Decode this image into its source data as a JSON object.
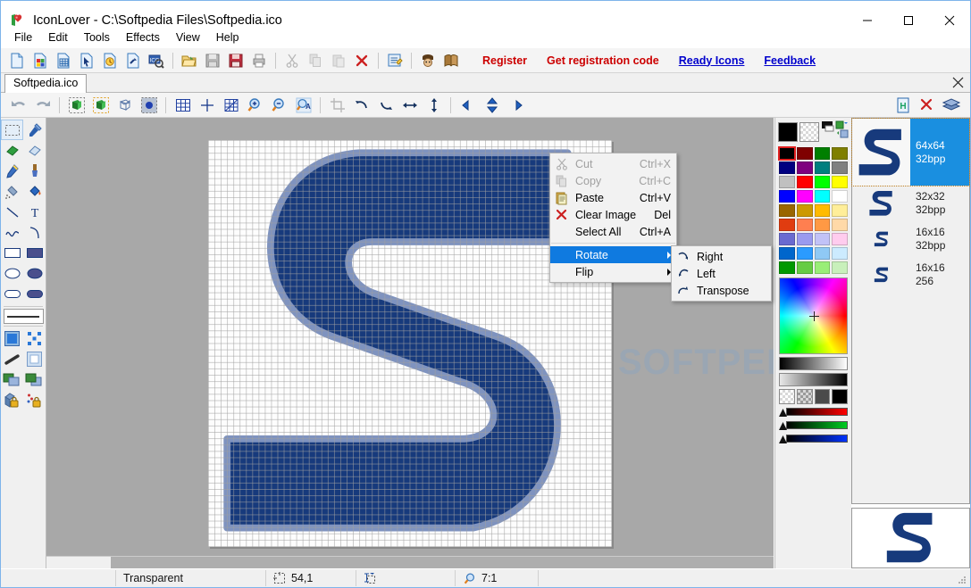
{
  "window": {
    "title": "IconLover - C:\\Softpedia Files\\Softpedia.ico",
    "app_icon": "heart-icon",
    "minimize_label": "—",
    "maximize_label": "□",
    "close_label": "✕"
  },
  "menubar": {
    "items": [
      {
        "label": "File"
      },
      {
        "label": "Edit"
      },
      {
        "label": "Tools"
      },
      {
        "label": "Effects"
      },
      {
        "label": "View"
      },
      {
        "label": "Help"
      }
    ]
  },
  "toolbar_main": {
    "icons": [
      {
        "name": "new-icon"
      },
      {
        "name": "new-image-icon"
      },
      {
        "name": "new-library-icon"
      },
      {
        "name": "new-cursor-icon"
      },
      {
        "name": "new-animated-cursor-icon"
      },
      {
        "name": "extract-icon"
      },
      {
        "name": "search-icons-icon"
      },
      {
        "name": "open-icon"
      },
      {
        "name": "save-icon"
      },
      {
        "name": "save-as-icon"
      },
      {
        "name": "print-icon"
      },
      {
        "name": "cut-icon"
      },
      {
        "name": "copy-icon"
      },
      {
        "name": "paste-icon"
      },
      {
        "name": "delete-icon"
      },
      {
        "name": "properties-icon"
      },
      {
        "name": "capture-icon"
      },
      {
        "name": "catalog-icon"
      }
    ],
    "links": [
      {
        "label": "Register",
        "style": "red"
      },
      {
        "label": "Get registration code",
        "style": "red"
      },
      {
        "label": "Ready Icons",
        "style": "blue-underline"
      },
      {
        "label": "Feedback",
        "style": "blue-underline"
      }
    ]
  },
  "tabstrip": {
    "tabs": [
      {
        "label": "Softpedia.ico",
        "active": true
      }
    ],
    "close_label": "✕"
  },
  "toolbar_edit": {
    "icons": [
      {
        "name": "undo-icon"
      },
      {
        "name": "redo-icon"
      },
      {
        "name": "image-normal-icon"
      },
      {
        "name": "image-selected-icon"
      },
      {
        "name": "image-3d-icon"
      },
      {
        "name": "image-mask-icon"
      },
      {
        "name": "grid-icon"
      },
      {
        "name": "crosshair-icon"
      },
      {
        "name": "pixel-grid-icon"
      },
      {
        "name": "zoom-in-icon"
      },
      {
        "name": "zoom-out-icon"
      },
      {
        "name": "zoom-actual-icon"
      },
      {
        "name": "crop-icon"
      },
      {
        "name": "rotate-left-icon"
      },
      {
        "name": "rotate-right-icon"
      },
      {
        "name": "flip-horizontal-icon"
      },
      {
        "name": "flip-vertical-icon"
      },
      {
        "name": "shift-left-icon"
      },
      {
        "name": "shift-vertical-icon"
      },
      {
        "name": "shift-right-icon"
      }
    ],
    "right_icons": [
      {
        "name": "save-page-icon"
      },
      {
        "name": "delete-page-icon"
      },
      {
        "name": "layers-icon"
      }
    ]
  },
  "toolpalette": {
    "tools": [
      {
        "name": "rectangle-select-tool",
        "selected": true
      },
      {
        "name": "color-picker-tool",
        "selected": false
      },
      {
        "name": "eraser-tool",
        "selected": false
      },
      {
        "name": "eraser-soft-tool",
        "selected": false
      },
      {
        "name": "pencil-tool",
        "selected": false
      },
      {
        "name": "brush-tool",
        "selected": false
      },
      {
        "name": "airbrush-tool",
        "selected": false
      },
      {
        "name": "paint-bucket-tool",
        "selected": false
      },
      {
        "name": "line-tool",
        "selected": false
      },
      {
        "name": "text-tool",
        "selected": false
      },
      {
        "name": "curve-tool",
        "selected": false
      },
      {
        "name": "arc-tool",
        "selected": false
      },
      {
        "name": "rectangle-outline-tool",
        "selected": false
      },
      {
        "name": "rectangle-filled-tool",
        "selected": false
      },
      {
        "name": "ellipse-outline-tool",
        "selected": false
      },
      {
        "name": "ellipse-filled-tool",
        "selected": false
      },
      {
        "name": "roundrect-outline-tool",
        "selected": false
      },
      {
        "name": "roundrect-filled-tool",
        "selected": false
      }
    ],
    "extras": [
      {
        "name": "fill-style-tool"
      },
      {
        "name": "scatter-tool"
      },
      {
        "name": "gradient-tool"
      },
      {
        "name": "blur-tool"
      },
      {
        "name": "layer-front-tool"
      },
      {
        "name": "layer-back-tool"
      },
      {
        "name": "lock-opacity-tool"
      },
      {
        "name": "lock-color-tool"
      }
    ]
  },
  "canvas": {
    "zoom_label": "7:1",
    "glyph": "S",
    "glyph_color": "#173a7c",
    "glyph_edge_color": "#7f93bf",
    "background": "#a8a8a8"
  },
  "palette": {
    "foreground_color": "#000000",
    "background_color": "transparent",
    "selected_index": 0,
    "swatches": [
      "#000000",
      "#7f0000",
      "#007f00",
      "#7f7f00",
      "#000080",
      "#7f007f",
      "#007f7f",
      "#808080",
      "#c0c0c0",
      "#ff0000",
      "#00ff00",
      "#ffff00",
      "#0000ff",
      "#ff00ff",
      "#00ffff",
      "#ffffff",
      "#996600",
      "#cc9900",
      "#ffbb00",
      "#ffee99",
      "#e03c10",
      "#ff7f50",
      "#ff9944",
      "#ffd9a8",
      "#6a6ad0",
      "#9a9aef",
      "#c2c2f7",
      "#ffccee",
      "#0066cc",
      "#2b9bff",
      "#8fc9f5",
      "#ccebff",
      "#009900",
      "#66cc44",
      "#99ee77",
      "#c8f0bb"
    ],
    "channel_bars": [
      {
        "name": "red-channel-slider",
        "color": "#ff0000"
      },
      {
        "name": "green-channel-slider",
        "color": "#00cc22"
      },
      {
        "name": "blue-channel-slider",
        "color": "#0033ff"
      }
    ]
  },
  "previews": {
    "items": [
      {
        "size": "64x64",
        "depth": "32bpp",
        "selected": true
      },
      {
        "size": "32x32",
        "depth": "32bpp",
        "selected": false
      },
      {
        "size": "16x16",
        "depth": "32bpp",
        "selected": false
      },
      {
        "size": "16x16",
        "depth": "256",
        "selected": false
      }
    ]
  },
  "statusbar": {
    "mode": "Transparent",
    "coords": "54,1",
    "zoom": "7:1",
    "coords_icon": "selection-icon",
    "size_icon": "resize-icon",
    "zoom_icon": "magnifier-icon"
  },
  "context_menu": {
    "items": [
      {
        "label": "Cut",
        "accel": "Ctrl+X",
        "icon": "scissors-icon",
        "disabled": true,
        "submenu": false,
        "highlighted": false
      },
      {
        "label": "Copy",
        "accel": "Ctrl+C",
        "icon": "copy-icon",
        "disabled": true,
        "submenu": false,
        "highlighted": false
      },
      {
        "label": "Paste",
        "accel": "Ctrl+V",
        "icon": "clipboard-icon",
        "disabled": false,
        "submenu": false,
        "highlighted": false
      },
      {
        "label": "Clear Image",
        "accel": "Del",
        "icon": "red-x-icon",
        "disabled": false,
        "submenu": false,
        "highlighted": false
      },
      {
        "label": "Select All",
        "accel": "Ctrl+A",
        "icon": "",
        "disabled": false,
        "submenu": false,
        "highlighted": false
      },
      {
        "label": "Rotate",
        "accel": "",
        "icon": "",
        "disabled": false,
        "submenu": true,
        "highlighted": true
      },
      {
        "label": "Flip",
        "accel": "",
        "icon": "",
        "disabled": false,
        "submenu": true,
        "highlighted": false
      }
    ],
    "divider_after_index": 4
  },
  "submenu": {
    "items": [
      {
        "label": "Right",
        "icon": "rotate-right-icon"
      },
      {
        "label": "Left",
        "icon": "rotate-left-icon"
      },
      {
        "label": "Transpose",
        "icon": "transpose-icon"
      }
    ]
  },
  "watermark": {
    "text": "SOFTPEDIA"
  }
}
